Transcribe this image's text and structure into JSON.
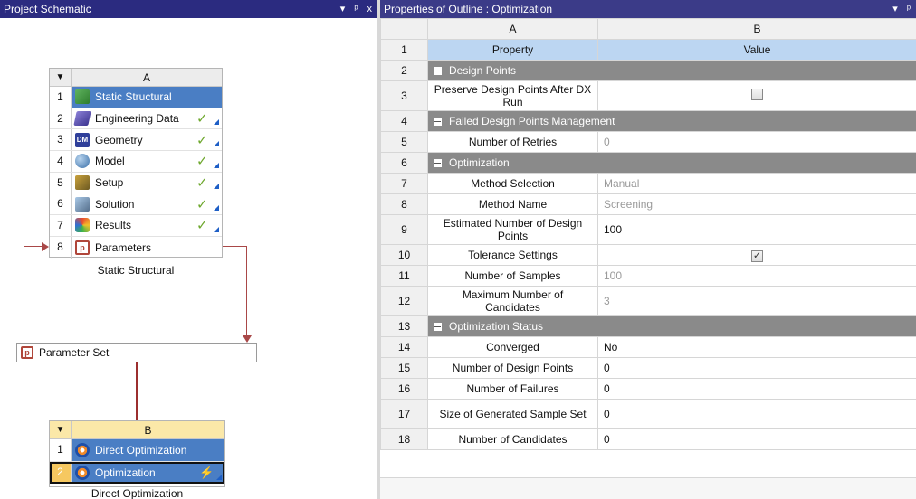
{
  "left_panel": {
    "title": "Project Schematic",
    "controls": [
      "▾",
      "ᵖ",
      "x"
    ],
    "system_a": {
      "column": "A",
      "caption": "Static Structural",
      "rows": [
        {
          "num": "1",
          "label": "Static Structural",
          "icon": "static-structural-icon",
          "status": ""
        },
        {
          "num": "2",
          "label": "Engineering Data",
          "icon": "engineering-data-icon",
          "status": "✓"
        },
        {
          "num": "3",
          "label": "Geometry",
          "icon": "geometry-icon",
          "status": "✓"
        },
        {
          "num": "4",
          "label": "Model",
          "icon": "model-icon",
          "status": "✓"
        },
        {
          "num": "5",
          "label": "Setup",
          "icon": "setup-icon",
          "status": "✓"
        },
        {
          "num": "6",
          "label": "Solution",
          "icon": "solution-icon",
          "status": "✓"
        },
        {
          "num": "7",
          "label": "Results",
          "icon": "results-icon",
          "status": "✓"
        },
        {
          "num": "8",
          "label": "Parameters",
          "icon": "parameters-icon",
          "status": ""
        }
      ]
    },
    "parameter_set": {
      "label": "Parameter Set",
      "icon": "parameters-icon"
    },
    "system_b": {
      "column": "B",
      "caption": "Direct Optimization",
      "rows": [
        {
          "num": "1",
          "label": "Direct Optimization",
          "icon": "direct-optimization-icon",
          "status": ""
        },
        {
          "num": "2",
          "label": "Optimization",
          "icon": "optimization-icon",
          "status": "⚡"
        }
      ]
    }
  },
  "right_panel": {
    "title": "Properties of Outline : Optimization",
    "controls": [
      "▾",
      "ᵖ"
    ],
    "col_a": "A",
    "col_b": "B",
    "rows": [
      {
        "n": "1",
        "a": "Property",
        "b": "Value",
        "kind": "prophead"
      },
      {
        "n": "2",
        "a": "Design Points",
        "kind": "group"
      },
      {
        "n": "3",
        "a": "Preserve Design Points After DX Run",
        "b": "",
        "kind": "checkbox",
        "checked": false,
        "tall": true
      },
      {
        "n": "4",
        "a": "Failed Design Points Management",
        "kind": "group"
      },
      {
        "n": "5",
        "a": "Number of Retries",
        "b": "0",
        "kind": "muted"
      },
      {
        "n": "6",
        "a": "Optimization",
        "kind": "group"
      },
      {
        "n": "7",
        "a": "Method Selection",
        "b": "Manual",
        "kind": "muted"
      },
      {
        "n": "8",
        "a": "Method Name",
        "b": "Screening",
        "kind": "muted"
      },
      {
        "n": "9",
        "a": "Estimated Number of Design Points",
        "b": "100",
        "kind": "value",
        "tall": true
      },
      {
        "n": "10",
        "a": "Tolerance Settings",
        "b": "",
        "kind": "checkbox",
        "checked": true
      },
      {
        "n": "11",
        "a": "Number of Samples",
        "b": "100",
        "kind": "muted"
      },
      {
        "n": "12",
        "a": "Maximum Number of Candidates",
        "b": "3",
        "kind": "muted",
        "tall": true
      },
      {
        "n": "13",
        "a": "Optimization Status",
        "kind": "group"
      },
      {
        "n": "14",
        "a": "Converged",
        "b": "No",
        "kind": "value"
      },
      {
        "n": "15",
        "a": "Number of Design Points",
        "b": "0",
        "kind": "value"
      },
      {
        "n": "16",
        "a": "Number of Failures",
        "b": "0",
        "kind": "value"
      },
      {
        "n": "17",
        "a": "Size of Generated Sample Set",
        "b": "0",
        "kind": "value",
        "tall": true
      },
      {
        "n": "18",
        "a": "Number of Candidates",
        "b": "0",
        "kind": "value"
      }
    ]
  },
  "colors": {
    "titlebar": "#2b2b80",
    "selected_row": "#4a7ec4",
    "group_row": "#8a8a8a",
    "property_header": "#bcd6f2",
    "link_wire": "#a94848",
    "check_green": "#6fa82f"
  }
}
